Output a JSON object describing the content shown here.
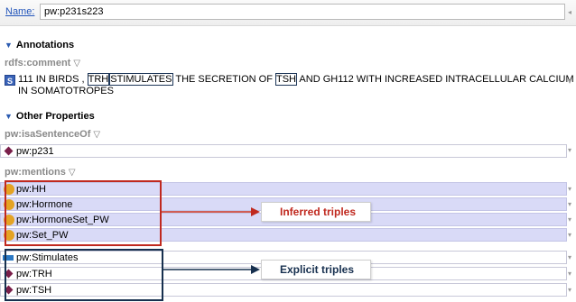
{
  "name_bar": {
    "label": "Name:",
    "value": "pw:p231s223"
  },
  "annotations": {
    "header": "Annotations",
    "property": "rdfs:comment",
    "badge": "S",
    "comment_parts": {
      "p1": "111 IN BIRDS , ",
      "hl1": "TRH",
      "hl2": "STIMULATES",
      "p2": " THE SECRETION OF ",
      "hl3": "TSH",
      "p3": " AND GH112 WITH INCREASED INTRACELLULAR CALCIUM",
      "line2": "IN SOMATOTROPES"
    }
  },
  "other_properties": {
    "header": "Other Properties",
    "sentence_of": {
      "property": "pw:isaSentenceOf",
      "value": "pw:p231"
    },
    "mentions": {
      "property": "pw:mentions",
      "inferred": [
        "pw:HH",
        "pw:Hormone",
        "pw:HormoneSet_PW",
        "pw:Set_PW"
      ],
      "explicit": [
        "pw:Stimulates",
        "pw:TRH",
        "pw:TSH"
      ]
    }
  },
  "callouts": {
    "inferred": "Inferred triples",
    "explicit": "Explicit triples"
  },
  "colors": {
    "inferred_row": "#d9daf7",
    "red": "#c0291f",
    "navy": "#17304f",
    "individual": "#7a1f4a",
    "class": "#e4a324",
    "property": "#2b78c4"
  },
  "icons": {
    "individual": "diamond-icon",
    "class": "circle-icon",
    "property": "bar-icon",
    "string": "s-badge-icon"
  }
}
